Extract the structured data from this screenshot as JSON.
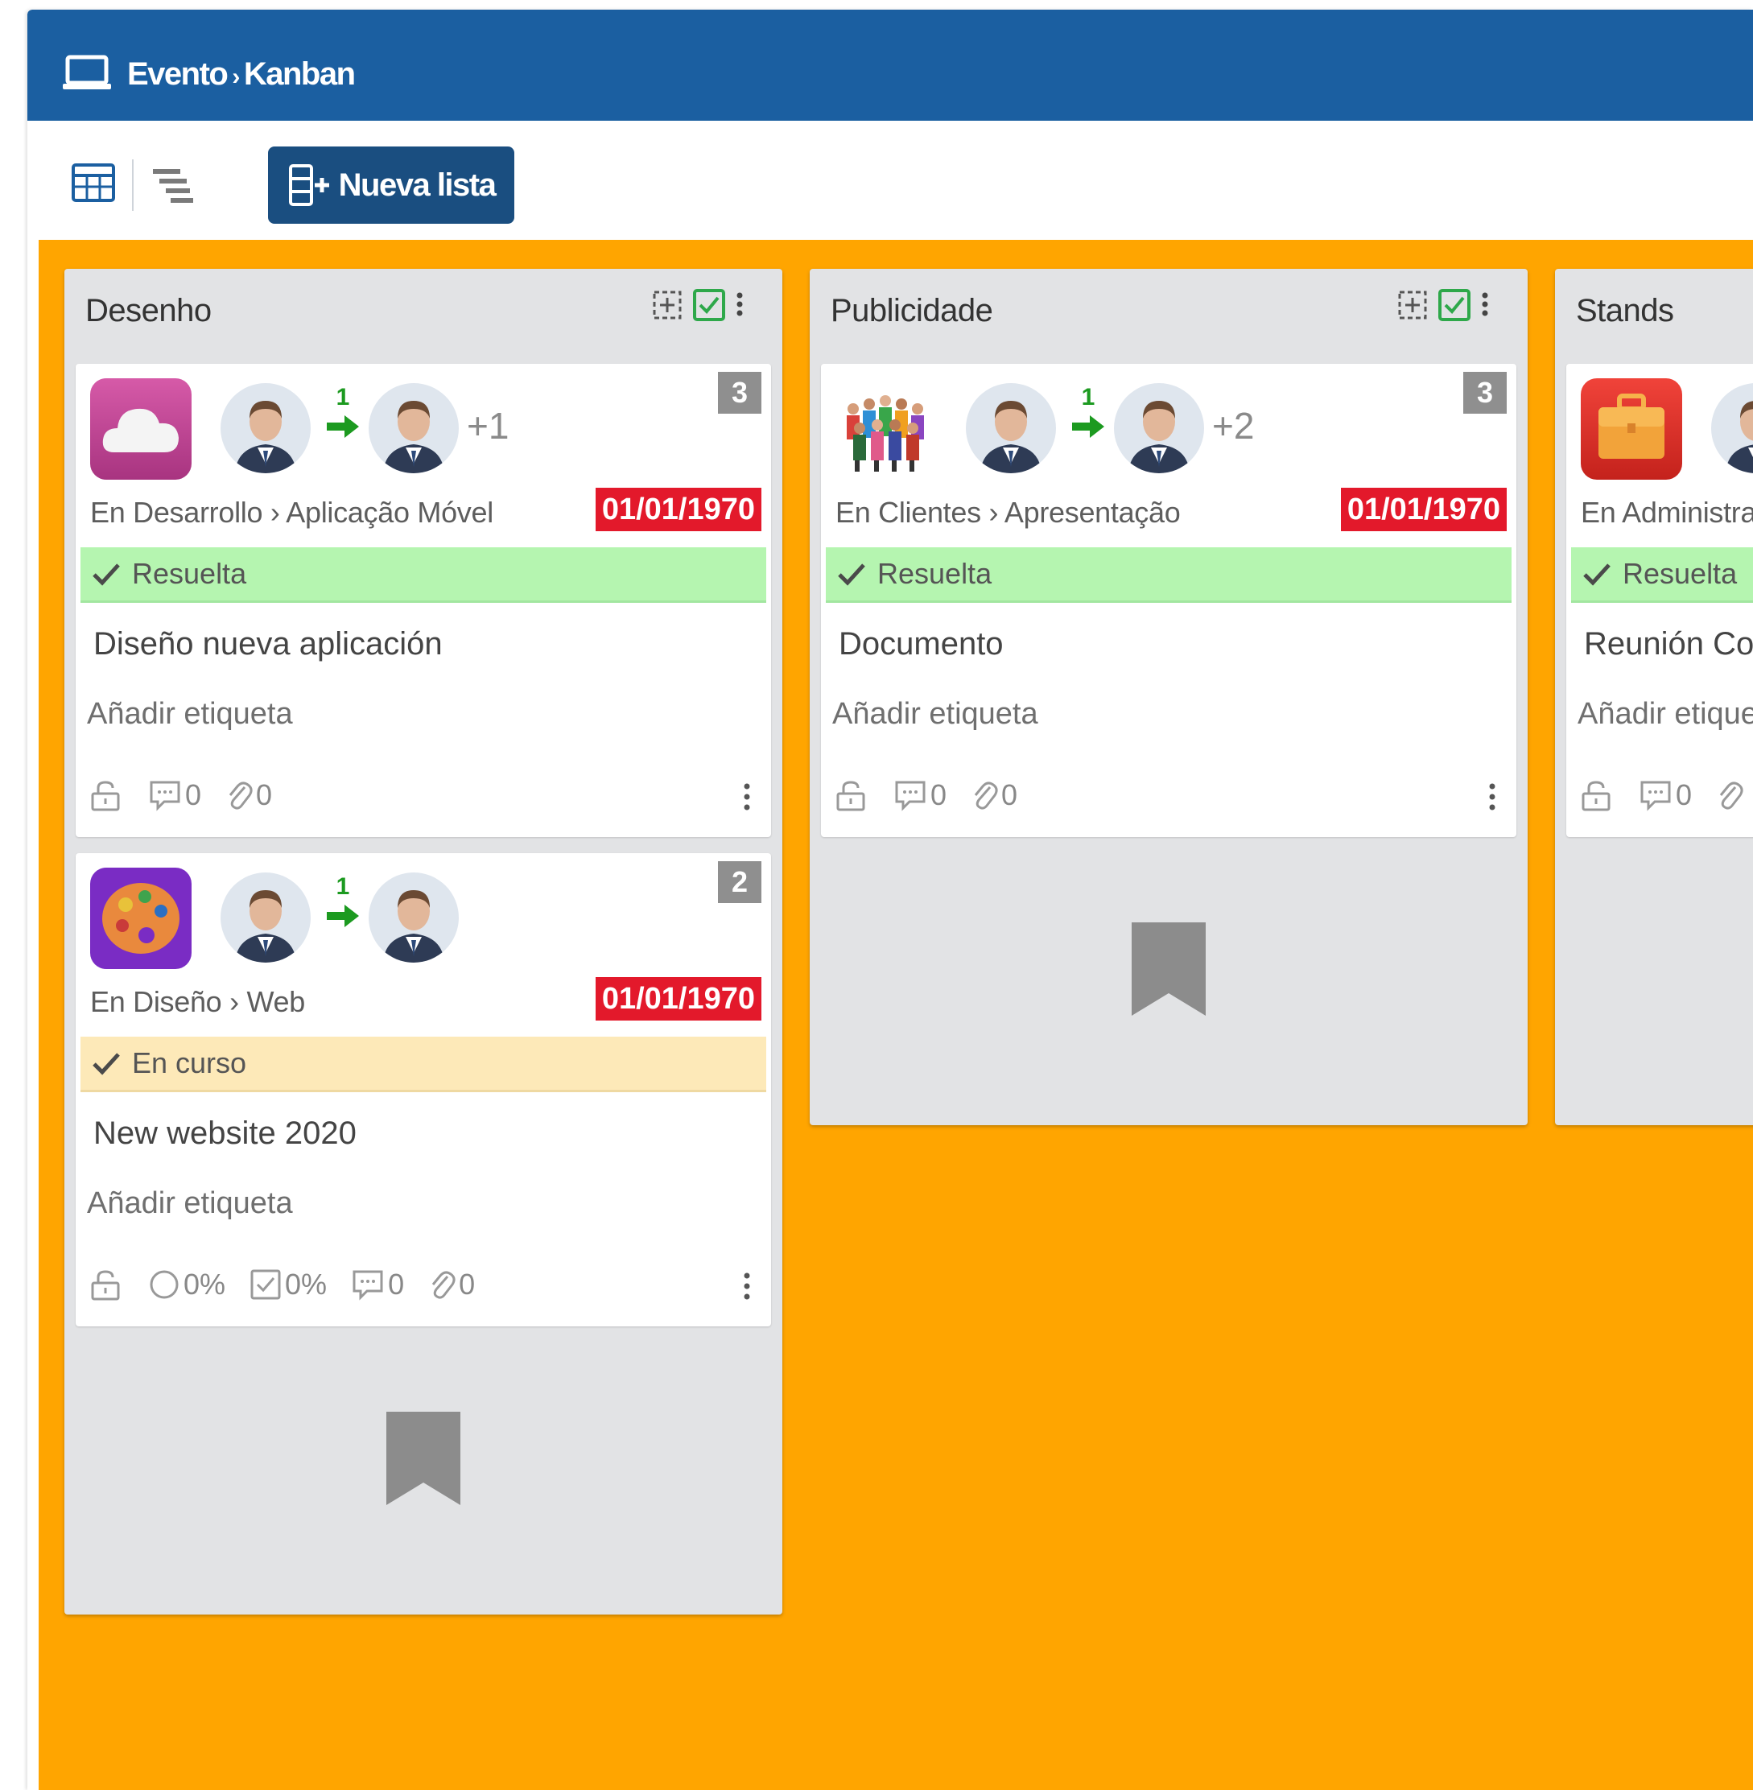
{
  "breadcrumb": {
    "module": "Evento",
    "separator": "›",
    "view": "Kanban"
  },
  "toolbar": {
    "new_list_label": "Nueva lista"
  },
  "colors": {
    "header_bg": "#1b5fa1",
    "board_bg": "#ffa500",
    "button_bg": "#1a4e80",
    "due_date_bg": "#e3192b",
    "resolved_bg": "#b5f5b0",
    "in_progress_bg": "#fde9b8",
    "arrow_green": "#1c9a20"
  },
  "columns": [
    {
      "title": "Desenho",
      "cards": [
        {
          "app_icon": "cloud-app-icon",
          "assignment_count": "1",
          "extra_assignees": "+1",
          "priority": "3",
          "path": "En Desarrollo › Aplicação Móvel",
          "due_date": "01/01/1970",
          "status": "Resuelta",
          "title": "Diseño nueva aplicación",
          "add_tag": "Añadir etiqueta",
          "comments": "0",
          "attachments": "0"
        },
        {
          "app_icon": "palette-app-icon",
          "assignment_count": "1",
          "priority": "2",
          "path": "En Diseño › Web",
          "due_date": "01/01/1970",
          "status": "En curso",
          "title": "New website 2020",
          "add_tag": "Añadir etiqueta",
          "progress": "0%",
          "checklist": "0%",
          "comments": "0",
          "attachments": "0"
        }
      ]
    },
    {
      "title": "Publicidade",
      "cards": [
        {
          "app_icon": "people-group-icon",
          "assignment_count": "1",
          "extra_assignees": "+2",
          "priority": "3",
          "path": "En Clientes › Apresentação",
          "due_date": "01/01/1970",
          "status": "Resuelta",
          "title": "Documento",
          "add_tag": "Añadir etiqueta",
          "comments": "0",
          "attachments": "0"
        }
      ]
    },
    {
      "title": "Stands",
      "cards": [
        {
          "app_icon": "briefcase-app-icon",
          "path": "En Administra",
          "status": "Resuelta",
          "title": "Reunión Cor",
          "add_tag": "Añadir etique",
          "comments": "0"
        }
      ]
    }
  ]
}
